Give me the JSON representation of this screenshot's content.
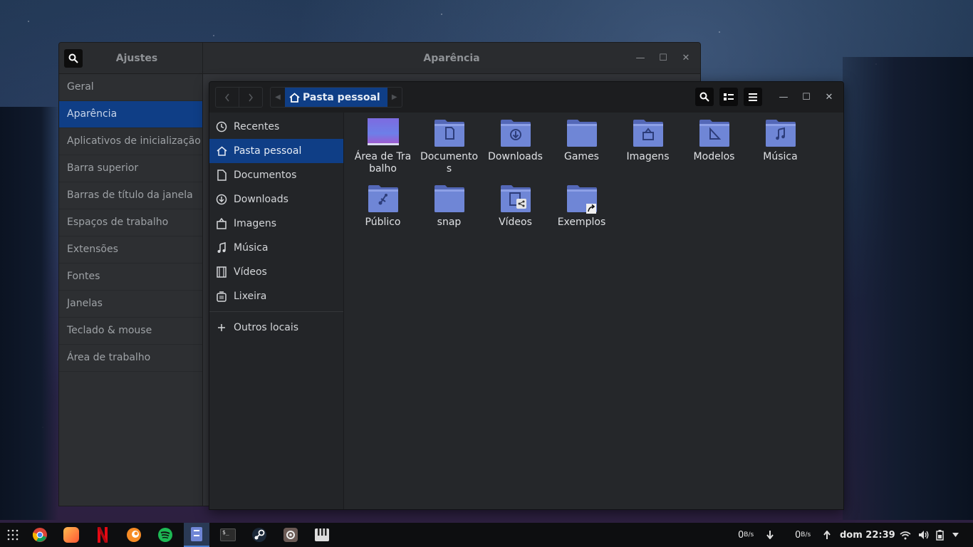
{
  "settings": {
    "sidebar_title": "Ajustes",
    "title": "Aparência",
    "items": [
      "Geral",
      "Aparência",
      "Aplicativos de inicialização",
      "Barra superior",
      "Barras de título da janela",
      "Espaços de trabalho",
      "Extensões",
      "Fontes",
      "Janelas",
      "Teclado & mouse",
      "Área de trabalho"
    ],
    "active_item": "Aparência"
  },
  "files": {
    "path": "Pasta pessoal",
    "sidebar": [
      {
        "label": "Recentes",
        "icon": "clock-icon"
      },
      {
        "label": "Pasta pessoal",
        "icon": "home-icon"
      },
      {
        "label": "Documentos",
        "icon": "document-icon"
      },
      {
        "label": "Downloads",
        "icon": "download-icon"
      },
      {
        "label": "Imagens",
        "icon": "image-icon"
      },
      {
        "label": "Música",
        "icon": "music-icon"
      },
      {
        "label": "Vídeos",
        "icon": "film-icon"
      },
      {
        "label": "Lixeira",
        "icon": "trash-icon"
      }
    ],
    "other_locations": "Outros locais",
    "folders": [
      {
        "name": "Área de Trabalho",
        "glyph": "desktop"
      },
      {
        "name": "Documentos",
        "glyph": "document"
      },
      {
        "name": "Downloads",
        "glyph": "download"
      },
      {
        "name": "Games",
        "glyph": "none"
      },
      {
        "name": "Imagens",
        "glyph": "image"
      },
      {
        "name": "Modelos",
        "glyph": "template"
      },
      {
        "name": "Música",
        "glyph": "music"
      },
      {
        "name": "Público",
        "glyph": "share"
      },
      {
        "name": "snap",
        "glyph": "none"
      },
      {
        "name": "Vídeos",
        "glyph": "video"
      },
      {
        "name": "Exemplos",
        "glyph": "link"
      }
    ]
  },
  "taskbar": {
    "net_down": "0",
    "net_down_unit": "B/s",
    "net_up": "0",
    "net_up_unit": "B/s",
    "clock": "dom 22:39",
    "terminal_glyph": "$_"
  },
  "colors": {
    "accent": "#0f3e86",
    "folder": "#6f86d6"
  }
}
